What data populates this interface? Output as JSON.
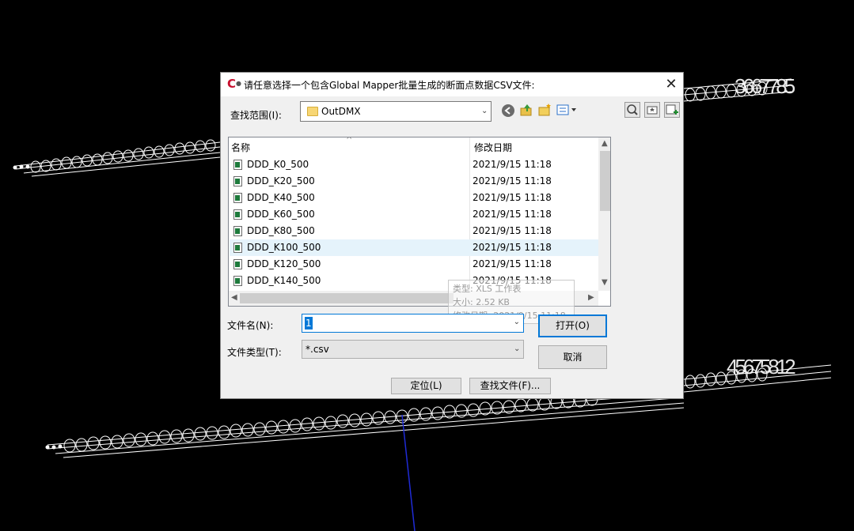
{
  "dialog": {
    "title": "请任意选择一个包含Global Mapper批量生成的断面点数据CSV文件:",
    "close_label": "✕",
    "look_in_label": "查找范围(I):",
    "look_in_value": "OutDMX",
    "columns": {
      "name": "名称",
      "date": "修改日期"
    },
    "files": [
      {
        "name": "DDD_K0_500",
        "date": "2021/9/15 11:18"
      },
      {
        "name": "DDD_K20_500",
        "date": "2021/9/15 11:18"
      },
      {
        "name": "DDD_K40_500",
        "date": "2021/9/15 11:18"
      },
      {
        "name": "DDD_K60_500",
        "date": "2021/9/15 11:18"
      },
      {
        "name": "DDD_K80_500",
        "date": "2021/9/15 11:18"
      },
      {
        "name": "DDD_K100_500",
        "date": "2021/9/15 11:18"
      },
      {
        "name": "DDD_K120_500",
        "date": "2021/9/15 11:18"
      },
      {
        "name": "DDD_K140_500",
        "date": "2021/9/15 11:18"
      }
    ],
    "tooltip": {
      "type": "类型: XLS 工作表",
      "size": "大小: 2.52 KB",
      "modified": "修改日期: 2021/9/15 11:18"
    },
    "filename_label": "文件名(N):",
    "filename_value": "1",
    "filetype_label": "文件类型(T):",
    "filetype_value": "*.csv",
    "open_label": "打开(O)",
    "cancel_label": "取消",
    "locate_label": "定位(L)",
    "find_file_label": "查找文件(F)..."
  },
  "cad": {
    "labels": [
      "3667785",
      "45675812"
    ]
  },
  "colors": {
    "accent": "#0078d7",
    "selected_row": "#e5f3fb",
    "background": "#000000"
  },
  "icons": [
    "app-logo-icon",
    "folder-icon",
    "back-icon",
    "up-folder-icon",
    "new-folder-icon",
    "view-menu-icon",
    "preview-icon",
    "tools-icon",
    "add-icon",
    "csv-file-icon"
  ]
}
